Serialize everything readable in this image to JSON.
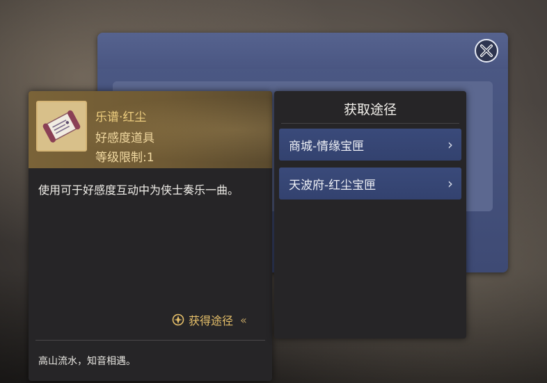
{
  "item": {
    "name": "乐谱·红尘",
    "type": "好感度道具",
    "level": "等级限制:1",
    "description": "使用可于好感度互动中为侠士奏乐一曲。",
    "obtain_link": "获得途径",
    "flavor": "高山流水，知音相遇。"
  },
  "sources": {
    "title": "获取途径",
    "items": [
      {
        "label": "商城-情缘宝匣"
      },
      {
        "label": "天波府-红尘宝匣"
      }
    ]
  },
  "colors": {
    "accent_gold": "#e6c06a",
    "source_item_bg": "#3a4a7a",
    "panel_bg": "#262527"
  },
  "icons": {
    "close": "close-icon",
    "item": "music-scroll-icon",
    "obtain": "compass-icon",
    "chevron": "chevron-right-icon"
  }
}
